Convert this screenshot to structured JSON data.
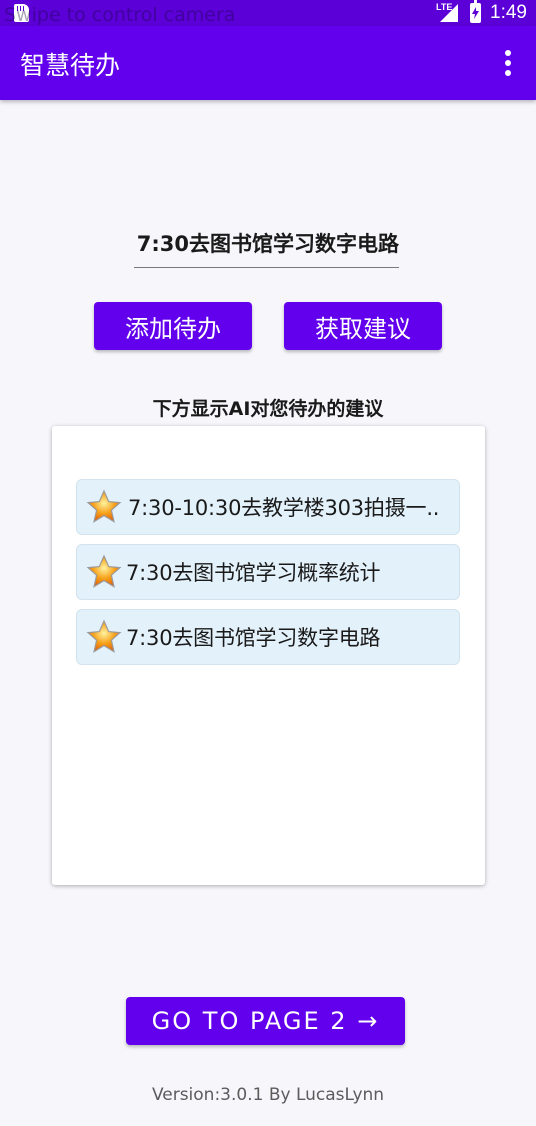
{
  "status_bar": {
    "overlay_text": "Swipe to control camera",
    "network": "LTE",
    "time": "1:49"
  },
  "app_bar": {
    "title": "智慧待办",
    "menu_icon": "more-vert-icon"
  },
  "todo_input": {
    "value": "7:30去图书馆学习数字电路"
  },
  "buttons": {
    "add": "添加待办",
    "suggest": "获取建议",
    "next_page": "GO TO PAGE 2 →"
  },
  "suggestion_label": "下方显示AI对您待办的建议",
  "todo_list": [
    {
      "icon": "star-icon",
      "text": "7:30-10:30去教学楼303拍摄一.."
    },
    {
      "icon": "star-icon",
      "text": "7:30去图书馆学习概率统计"
    },
    {
      "icon": "star-icon",
      "text": "7:30去图书馆学习数字电路"
    }
  ],
  "footer": {
    "version": "Version:3.0.1 By LucasLynn"
  },
  "colors": {
    "primary": "#6200ee",
    "status_bar": "#5b00d6",
    "list_item_bg": "#e3f1fb",
    "star": "#f7a21b"
  }
}
